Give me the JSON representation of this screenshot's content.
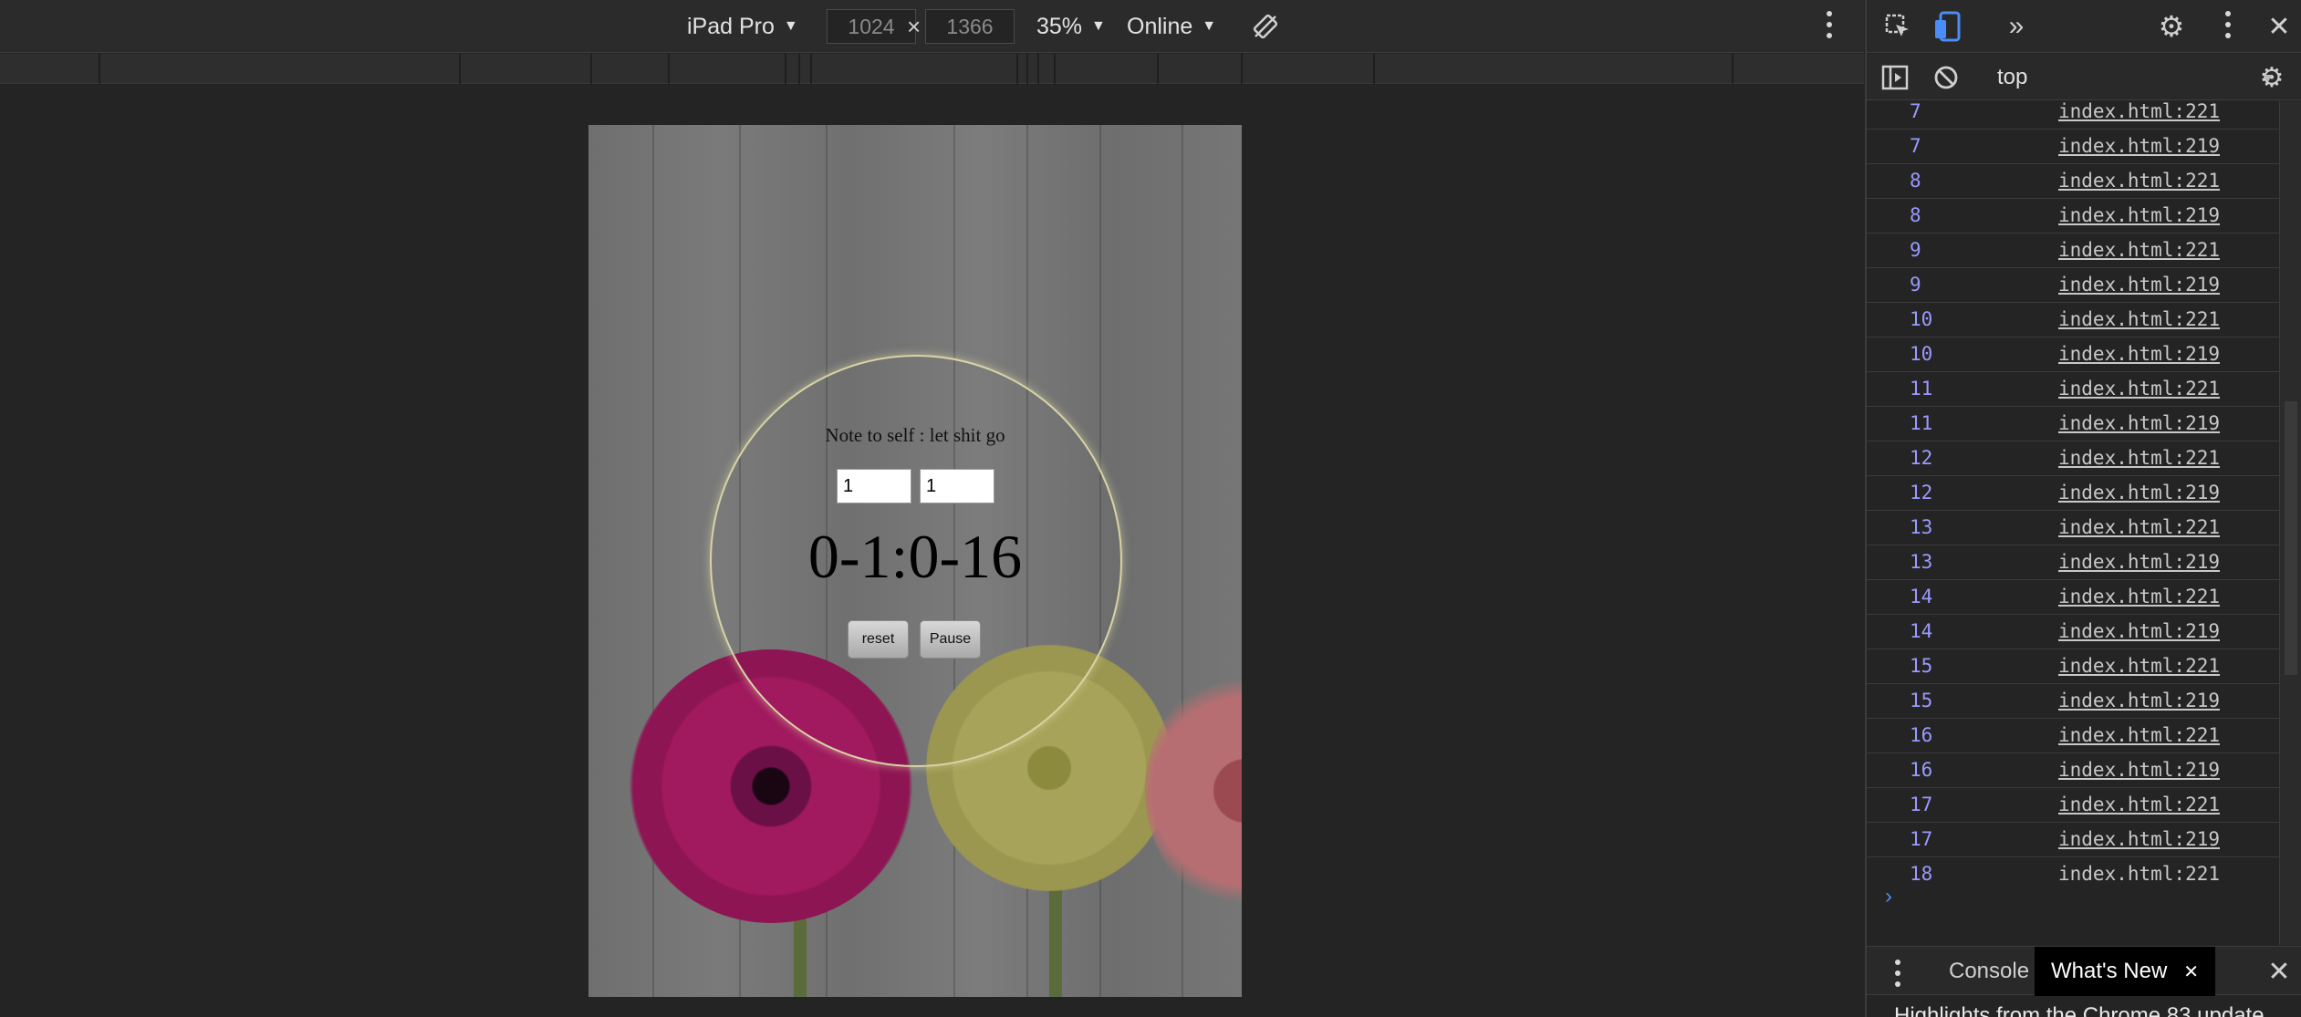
{
  "device_toolbar": {
    "device": "iPad Pro",
    "width": "1024",
    "times": "×",
    "height": "1366",
    "zoom": "35%",
    "network": "Online"
  },
  "page": {
    "note": "Note to self : let shit go",
    "input_1": "1",
    "input_2": "1",
    "timer": "0-1:0-16",
    "reset_label": "reset",
    "pause_label": "Pause"
  },
  "devtools": {
    "context": "top",
    "prompt": "›",
    "console_rows": [
      {
        "n": "7",
        "src": "index.html:221"
      },
      {
        "n": "7",
        "src": "index.html:219"
      },
      {
        "n": "8",
        "src": "index.html:221"
      },
      {
        "n": "8",
        "src": "index.html:219"
      },
      {
        "n": "9",
        "src": "index.html:221"
      },
      {
        "n": "9",
        "src": "index.html:219"
      },
      {
        "n": "10",
        "src": "index.html:221"
      },
      {
        "n": "10",
        "src": "index.html:219"
      },
      {
        "n": "11",
        "src": "index.html:221"
      },
      {
        "n": "11",
        "src": "index.html:219"
      },
      {
        "n": "12",
        "src": "index.html:221"
      },
      {
        "n": "12",
        "src": "index.html:219"
      },
      {
        "n": "13",
        "src": "index.html:221"
      },
      {
        "n": "13",
        "src": "index.html:219"
      },
      {
        "n": "14",
        "src": "index.html:221"
      },
      {
        "n": "14",
        "src": "index.html:219"
      },
      {
        "n": "15",
        "src": "index.html:221"
      },
      {
        "n": "15",
        "src": "index.html:219"
      },
      {
        "n": "16",
        "src": "index.html:221"
      },
      {
        "n": "16",
        "src": "index.html:219"
      },
      {
        "n": "17",
        "src": "index.html:221"
      },
      {
        "n": "17",
        "src": "index.html:219"
      },
      {
        "n": "18",
        "src": "index.html:221"
      }
    ],
    "drawer": {
      "tab_console": "Console",
      "tab_whats_new": "What's New",
      "content": "Highlights from the Chrome 83 update"
    }
  },
  "colors": {
    "accent_blue": "#4a8df8",
    "console_number": "#9a9aff",
    "panel_bg": "#242424"
  }
}
